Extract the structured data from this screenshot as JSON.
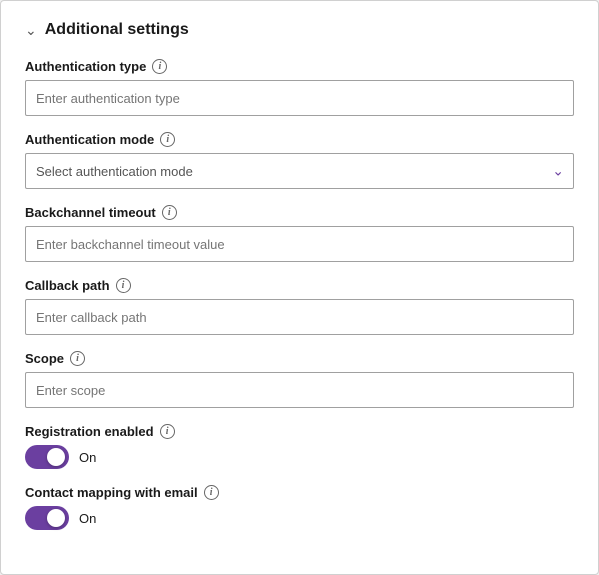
{
  "section": {
    "title": "Additional settings",
    "chevron": "▾"
  },
  "fields": {
    "auth_type": {
      "label": "Authentication type",
      "placeholder": "Enter authentication type"
    },
    "auth_mode": {
      "label": "Authentication mode",
      "placeholder": "Select authentication mode"
    },
    "backchannel_timeout": {
      "label": "Backchannel timeout",
      "placeholder": "Enter backchannel timeout value"
    },
    "callback_path": {
      "label": "Callback path",
      "placeholder": "Enter callback path"
    },
    "scope": {
      "label": "Scope",
      "placeholder": "Enter scope"
    },
    "registration_enabled": {
      "label": "Registration enabled",
      "toggle_label": "On",
      "enabled": true
    },
    "contact_mapping": {
      "label": "Contact mapping with email",
      "toggle_label": "On",
      "enabled": true
    }
  },
  "icons": {
    "info": "i",
    "chevron_down": "⌄",
    "chevron_section": "›"
  }
}
